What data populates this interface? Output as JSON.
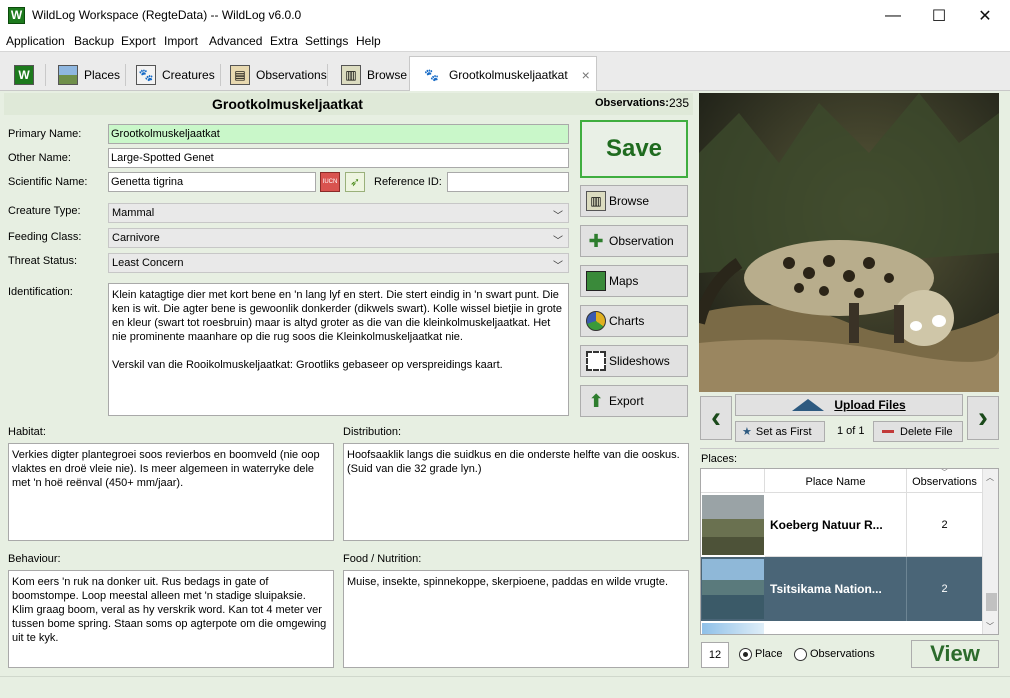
{
  "window": {
    "title": "WildLog Workspace (RegteData) -- WildLog v6.0.0",
    "min": "—",
    "max": "☐",
    "close": "✕"
  },
  "menu": [
    "Application",
    "Backup",
    "Export",
    "Import",
    "Advanced",
    "Extra",
    "Settings",
    "Help"
  ],
  "tabs": {
    "places": "Places",
    "creatures": "Creatures",
    "observations": "Observations",
    "browse": "Browse",
    "active": "Grootkolmuskeljaatkat",
    "close": "×"
  },
  "header": {
    "title": "Grootkolmuskeljaatkat",
    "obs_label": "Observations:",
    "obs_count": "235"
  },
  "form": {
    "primary_name_label": "Primary Name:",
    "primary_name": "Grootkolmuskeljaatkat",
    "other_name_label": "Other Name:",
    "other_name": "Large-Spotted Genet",
    "scientific_label": "Scientific Name:",
    "scientific": "Genetta tigrina",
    "reference_label": "Reference ID:",
    "reference": "",
    "creature_type_label": "Creature Type:",
    "creature_type": "Mammal",
    "feeding_label": "Feeding Class:",
    "feeding": "Carnivore",
    "threat_label": "Threat Status:",
    "threat": "Least Concern",
    "identification_label": "Identification:",
    "identification": "Klein katagtige dier met kort bene en 'n lang lyf en stert. Die stert eindig in 'n swart punt. Die ken is wit. Die agter bene is gewoonlik donkerder (dikwels swart). Kolle wissel bietjie in grote en kleur (swart tot roesbruin) maar is altyd groter as die van die kleinkolmuskeljaatkat. Het nie prominente maanhare op die rug soos die Kleinkolmuskeljaatkat nie.\n\nVerskil van die Rooikolmuskeljaatkat: Grootliks gebaseer op verspreidings kaart.",
    "habitat_label": "Habitat:",
    "habitat": "Verkies digter plantegroei soos revierbos en boomveld (nie oop vlaktes en droë vleie nie). Is meer algemeen in waterryke dele met 'n hoë reënval (450+ mm/jaar).",
    "distribution_label": "Distribution:",
    "distribution": "Hoofsaaklik langs die suidkus en die onderste helfte van die ooskus. (Suid van die 32 grade lyn.)",
    "behaviour_label": "Behaviour:",
    "behaviour": "Kom eers 'n ruk na donker uit. Rus bedags in gate of boomstompe. Loop meestal alleen met 'n stadige sluipaksie. Klim graag boom, veral as hy verskrik word. Kan tot 4 meter ver tussen bome spring. Staan soms op agterpote om die omgewing uit te kyk.",
    "food_label": "Food / Nutrition:",
    "food": "Muise, insekte, spinnekoppe, skerpioene, paddas en wilde vrugte."
  },
  "buttons": {
    "save": "Save",
    "browse": "Browse",
    "observation": "Observation",
    "maps": "Maps",
    "charts": "Charts",
    "slideshows": "Slideshows",
    "export": "Export",
    "iucn": "IUCN"
  },
  "gallery": {
    "upload": "Upload Files",
    "set_first": "Set as First",
    "counter": "1 of 1",
    "delete": "Delete File",
    "prev": "‹",
    "next": "›"
  },
  "places": {
    "label": "Places:",
    "col_name": "Place Name",
    "col_obs": "Observations",
    "rows": [
      {
        "name": "Koeberg Natuur R...",
        "obs": "2"
      },
      {
        "name": "Tsitsikama Nation...",
        "obs": "2"
      }
    ],
    "count": "12",
    "radio_place": "Place",
    "radio_obs": "Observations",
    "view": "View"
  },
  "colors": {
    "accent_green": "#1f6b1f",
    "selected_row": "#4a6577",
    "primary_bg": "#c9f7c9"
  }
}
